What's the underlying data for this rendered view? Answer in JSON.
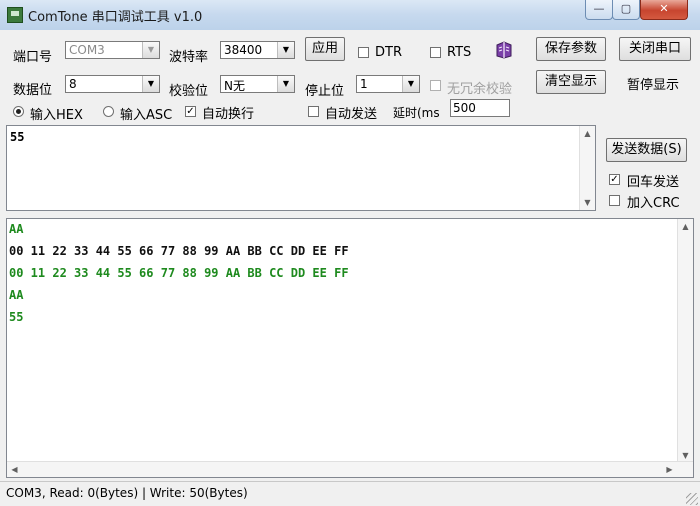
{
  "window": {
    "title": "ComTone 串口调试工具 v1.0",
    "controls": {
      "minimize": "—",
      "maximize": "▢",
      "close": "✕"
    }
  },
  "settings": {
    "port": {
      "label": "端口号",
      "value": "COM3"
    },
    "baud": {
      "label": "波特率",
      "value": "38400"
    },
    "apply_label": "应用",
    "dtr_label": "DTR",
    "rts_label": "RTS",
    "data_bits": {
      "label": "数据位",
      "value": "8"
    },
    "parity": {
      "label": "校验位",
      "value": "N无"
    },
    "stop_bits": {
      "label": "停止位",
      "value": "1"
    },
    "redundancy_label": "无冗余校验",
    "input_hex_label": "输入HEX",
    "input_asc_label": "输入ASC",
    "auto_newline_label": "自动换行",
    "auto_send_label": "自动发送",
    "delay_label": "延时(ms",
    "delay_value": "500"
  },
  "actions": {
    "save_params": "保存参数",
    "close_port": "关闭串口",
    "clear_display": "清空显示",
    "pause_display": "暂停显示",
    "send_data": "发送数据(S)",
    "cr_send": "回车发送",
    "add_crc": "加入CRC"
  },
  "send_text": "55",
  "receive_lines": [
    {
      "text": "AA",
      "color": "#1e8a1e"
    },
    {
      "text": "00 11 22 33 44 55 66 77 88 99 AA BB CC DD EE FF",
      "color": "#111111"
    },
    {
      "text": "00 11 22 33 44 55 66 77 88 99 AA BB CC DD EE FF",
      "color": "#1e8a1e"
    },
    {
      "text": "AA",
      "color": "#1e8a1e"
    },
    {
      "text": "55",
      "color": "#1e8a1e"
    }
  ],
  "status_text": "COM3, Read: 0(Bytes) | Write: 50(Bytes)",
  "checkboxes": {
    "dtr": false,
    "rts": false,
    "redundancy": false,
    "auto_newline": true,
    "auto_send": false,
    "cr_send": true,
    "add_crc": false
  }
}
